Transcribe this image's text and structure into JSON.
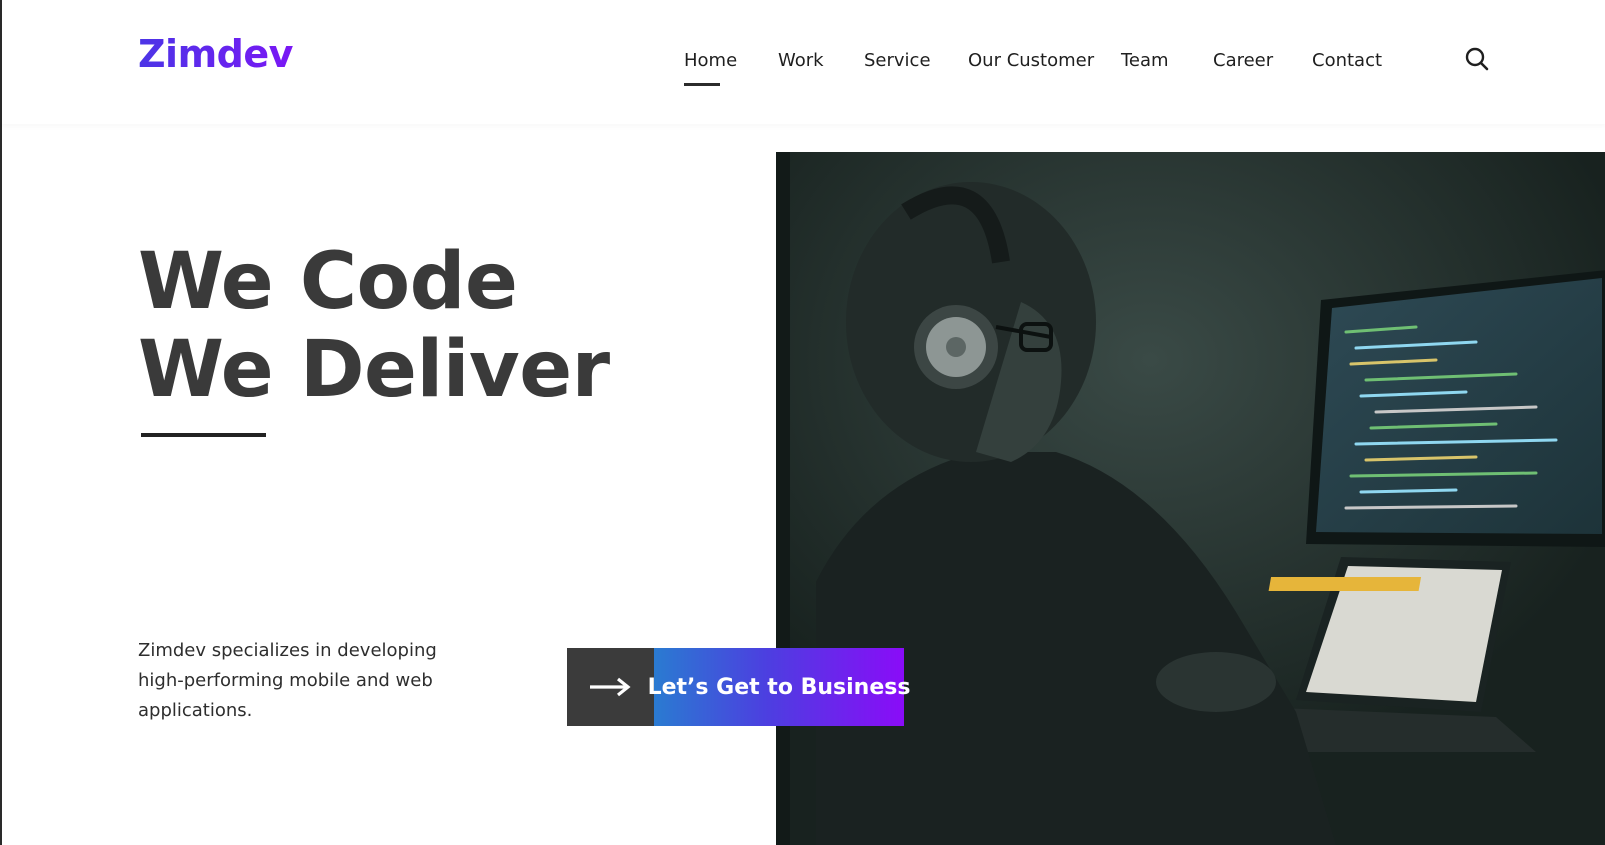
{
  "brand": {
    "name": "Zimdev"
  },
  "nav": {
    "items": [
      {
        "label": "Home",
        "active": true
      },
      {
        "label": "Work",
        "active": false
      },
      {
        "label": "Service",
        "active": false
      },
      {
        "label": "Our Customer",
        "active": false
      },
      {
        "label": "Team",
        "active": false
      },
      {
        "label": "Career",
        "active": false
      },
      {
        "label": "Contact",
        "active": false
      }
    ],
    "search_icon": "search-icon"
  },
  "hero": {
    "title_line1": "We Code",
    "title_line2": "We Deliver",
    "description": "Zimdev specializes in developing high-performing mobile and web applications.",
    "cta_label": "Let’s Get to Business",
    "cta_icon": "arrow-right-icon",
    "image_subject": "photo-developer-with-headphones"
  },
  "colors": {
    "brand_gradient_start": "#4c35e6",
    "brand_gradient_end": "#7a17f5",
    "cta_gradient_start": "#2a7bd1",
    "cta_gradient_end": "#8a0cf8",
    "dark": "#3b3b3b",
    "image_bg": "#1d2a27"
  }
}
